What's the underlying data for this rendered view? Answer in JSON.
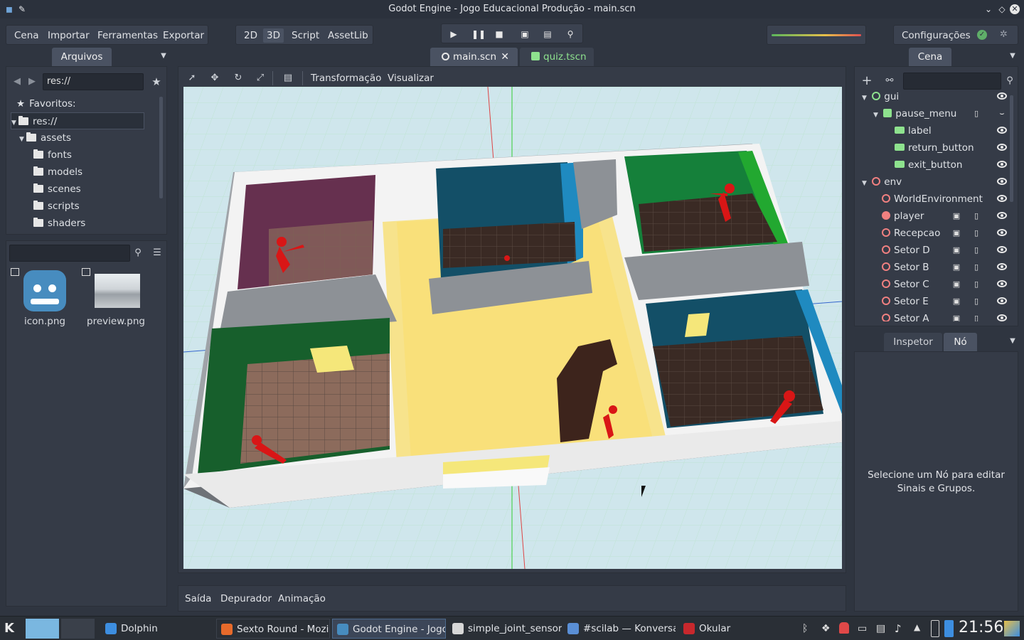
{
  "window": {
    "title": "Godot Engine - Jogo Educacional Produção - main.scn"
  },
  "menu": {
    "items": [
      "Cena",
      "Importar",
      "Ferramentas",
      "Exportar"
    ]
  },
  "modes": {
    "items": [
      "2D",
      "3D",
      "Script",
      "AssetLib"
    ],
    "active": "3D"
  },
  "play_controls": [
    "play-icon",
    "pause-icon",
    "stop-icon",
    "play-scene-icon",
    "play-custom-icon",
    "remote-debug-icon"
  ],
  "settings": {
    "label": "Configurações"
  },
  "filesystem": {
    "tab": "Arquivos",
    "path": "res://",
    "tree": [
      {
        "label": "Favoritos:",
        "kind": "favorites"
      },
      {
        "label": "res://",
        "kind": "folder",
        "selected": true
      },
      {
        "label": "assets",
        "kind": "folder"
      },
      {
        "label": "fonts",
        "kind": "folder"
      },
      {
        "label": "models",
        "kind": "folder"
      },
      {
        "label": "scenes",
        "kind": "folder"
      },
      {
        "label": "scripts",
        "kind": "folder"
      },
      {
        "label": "shaders",
        "kind": "folder"
      }
    ],
    "files": [
      {
        "name": "icon.png"
      },
      {
        "name": "preview.png"
      }
    ]
  },
  "editor_tabs": [
    {
      "label": "main.scn",
      "active": true
    },
    {
      "label": "quiz.tscn",
      "active": false
    }
  ],
  "viewport": {
    "toolbar": {
      "transform": "Transformação",
      "view": "Visualizar"
    }
  },
  "bottom_tabs": [
    "Saída",
    "Depurador",
    "Animação"
  ],
  "scene": {
    "tab": "Cena",
    "nodes": [
      {
        "label": "gui",
        "depth": 1,
        "color": "#8ee28e",
        "expanded": true
      },
      {
        "label": "pause_menu",
        "depth": 2,
        "color": "#8ee28e",
        "expanded": true
      },
      {
        "label": "label",
        "depth": 3,
        "color": "#8ee28e"
      },
      {
        "label": "return_button",
        "depth": 3,
        "color": "#8ee28e"
      },
      {
        "label": "exit_button",
        "depth": 3,
        "color": "#8ee28e"
      },
      {
        "label": "env",
        "depth": 1,
        "color": "#f08080",
        "expanded": true
      },
      {
        "label": "WorldEnvironment",
        "depth": 2,
        "color": "#f08080"
      },
      {
        "label": "player",
        "depth": 2,
        "color": "#f08080"
      },
      {
        "label": "Recepcao",
        "depth": 2,
        "color": "#f08080"
      },
      {
        "label": "Setor D",
        "depth": 2,
        "color": "#f08080"
      },
      {
        "label": "Setor B",
        "depth": 2,
        "color": "#f08080"
      },
      {
        "label": "Setor C",
        "depth": 2,
        "color": "#f08080"
      },
      {
        "label": "Setor E",
        "depth": 2,
        "color": "#f08080"
      },
      {
        "label": "Setor A",
        "depth": 2,
        "color": "#f08080"
      }
    ]
  },
  "inspector": {
    "tabs": [
      "Inspetor",
      "Nó"
    ],
    "active": "Nó",
    "message": "Selecione um Nó para editar Sinais e Grupos."
  },
  "taskbar": {
    "tasks": [
      {
        "label": "Dolphin",
        "color": "#3d8ee0"
      },
      {
        "label": "Sexto Round - Mozill",
        "color": "#e76a2b"
      },
      {
        "label": "Godot Engine - Jogo",
        "color": "#478cbf"
      },
      {
        "label": "simple_joint_sensor_",
        "color": "#d7d7d7"
      },
      {
        "label": "#scilab — Konversat",
        "color": "#5a8fd6"
      },
      {
        "label": "Okular",
        "color": "#c8282d"
      }
    ],
    "clock": "21:56"
  }
}
